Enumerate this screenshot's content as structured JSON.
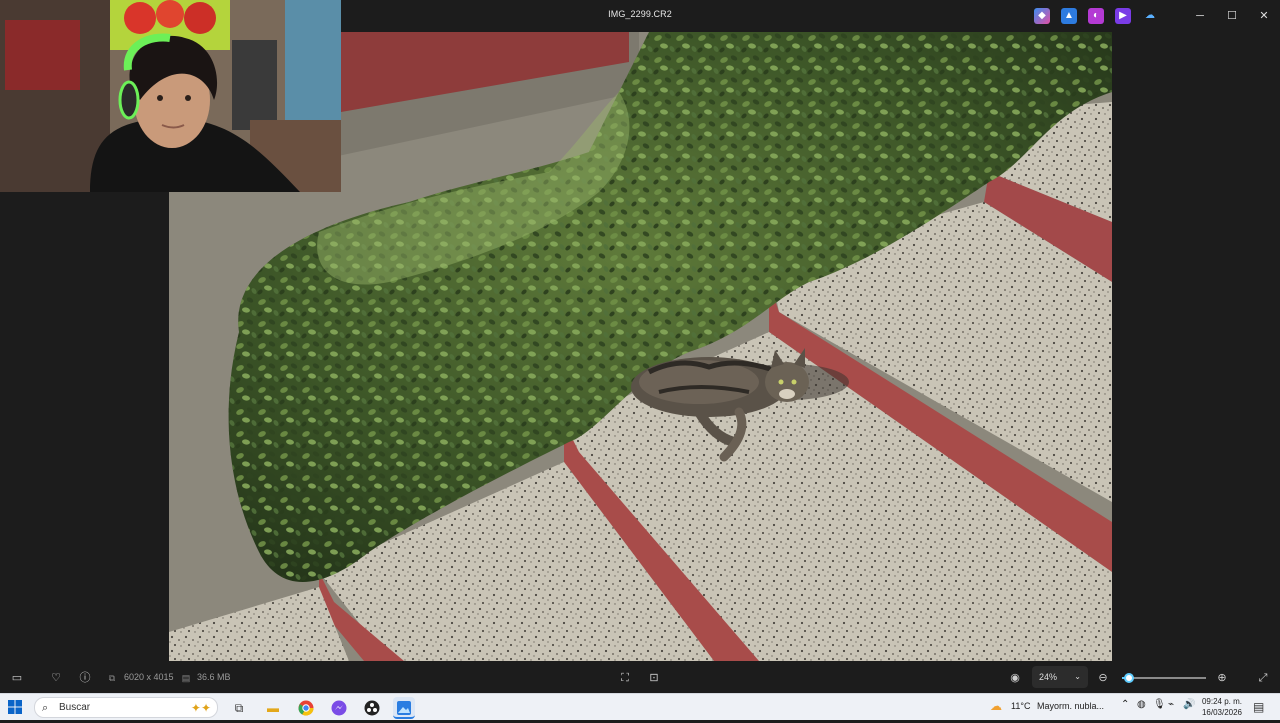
{
  "window": {
    "title": "IMG_2299.CR2",
    "minimize_glyph": "─",
    "maximize_glyph": "☐",
    "close_glyph": "✕"
  },
  "extensions": [
    {
      "icon": "copilot-icon",
      "color": "#3b8ef0"
    },
    {
      "icon": "designer-icon",
      "color": "#2d7be0"
    },
    {
      "icon": "clipchamp-icon",
      "color": "#b43ad4"
    },
    {
      "icon": "video-editor-icon",
      "color": "#7a3ce6"
    },
    {
      "icon": "onedrive-icon",
      "color": "#2a8de8"
    }
  ],
  "image_info": {
    "dimensions": "6020 x 4015",
    "file_size": "36.6 MB"
  },
  "zoom": {
    "level": "24%",
    "slider_fraction": 0.08
  },
  "taskbar": {
    "search_placeholder": "Buscar",
    "weather_temp": "11°C",
    "weather_text": "Mayorm. nubla...",
    "time": "09:24 p. m.",
    "date": "16/03/2026",
    "pinned_apps": [
      {
        "icon": "task-view-icon",
        "color": "#444"
      },
      {
        "icon": "file-explorer-icon",
        "color": "#f4c430"
      },
      {
        "icon": "chrome-icon",
        "color": "#e84135"
      },
      {
        "icon": "messenger-icon",
        "color": "#7a4ce6"
      },
      {
        "icon": "obs-icon",
        "color": "#222"
      },
      {
        "icon": "photos-icon",
        "color": "#2a7de1"
      }
    ]
  },
  "colors": {
    "accent": "#60cdff",
    "background": "#1c1c1c"
  }
}
